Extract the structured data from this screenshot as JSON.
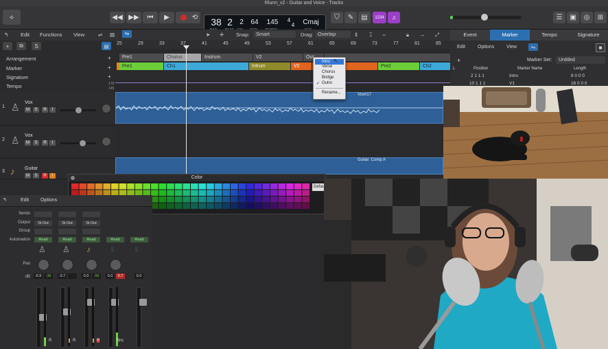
{
  "window": {
    "title": "Rlunn_v2 - Guitar and Voice - Tracks"
  },
  "transport": {
    "bar": "38",
    "beat": "2",
    "division": "2",
    "tick": "64",
    "tempo": "145",
    "timesig_top": "4",
    "timesig_bottom": "4",
    "key": "Cmaj",
    "bar_label": "BAR",
    "beat_label": "BEAT",
    "div_label": "DIV",
    "tick_label": "TICK",
    "tempo_label": "TEMPO",
    "key_label": "KEY",
    "cpu_label": "1234"
  },
  "menubar": {
    "edit": "Edit",
    "functions": "Functions",
    "view": "View",
    "snap_label": "Snap:",
    "snap_value": "Smart",
    "drag_label": "Drag:",
    "drag_value": "Overlap"
  },
  "ruler": {
    "bars": [
      "25",
      "29",
      "33",
      "37",
      "41",
      "45",
      "49",
      "53",
      "57",
      "61",
      "65",
      "69",
      "73",
      "77",
      "81",
      "85"
    ]
  },
  "global_tracks": {
    "labels": [
      "Arrangement",
      "Marker",
      "Signature",
      "Tempo"
    ],
    "arrangement": [
      "Pre1",
      "Chorus",
      "Instrum",
      "V2",
      "Out"
    ],
    "markers": [
      "Pre1",
      "Ch1",
      "Intrum",
      "V2",
      "Pre2",
      "Ch2"
    ],
    "tempo_values": [
      "170",
      "145"
    ]
  },
  "dropdown": {
    "items": [
      "Intro",
      "Verse",
      "Chorus",
      "Bridge",
      "Outro"
    ],
    "checked": "Outro",
    "rename": "Rename..."
  },
  "tracks": [
    {
      "num": "1",
      "name": "Vox",
      "region": "Vox#17"
    },
    {
      "num": "2",
      "name": "Vox",
      "region": ""
    },
    {
      "num": "3",
      "name": "Guitar",
      "region": "Guitar: Comp A"
    }
  ],
  "color_window": {
    "title": "Color",
    "default_btn": "Default"
  },
  "mixer": {
    "edit": "Edit",
    "options": "Options",
    "row_labels": {
      "sends": "Sends",
      "output": "Output",
      "group": "Group",
      "automation": "Automation",
      "pan": "Pan",
      "db": "dB"
    },
    "strips": [
      {
        "output": "St Out",
        "automation": "Read",
        "db1": "-5.9",
        "db2": "-36"
      },
      {
        "output": "St Out",
        "automation": "Read",
        "db1": "-3.7",
        "db2": ""
      },
      {
        "output": "St Out",
        "automation": "Read",
        "db1": "0.0",
        "db2": "-50"
      },
      {
        "output": "",
        "automation": "Read",
        "db1": "0.0",
        "db2": "0.7"
      },
      {
        "output": "",
        "automation": "Read",
        "db1": "0.0",
        "db2": ""
      }
    ],
    "bnc_label": "Bnc"
  },
  "inspector": {
    "tabs": [
      "Event",
      "Marker",
      "Tempo",
      "Signature"
    ],
    "active_tab": "Marker",
    "edit": "Edit",
    "functions": "Options",
    "view": "View",
    "marker_set_label": "Marker Set:",
    "marker_set_value": "Untitled",
    "columns": [
      "L",
      "Position",
      "Marker Name",
      "Length"
    ],
    "rows": [
      {
        "position": "2 1 1 1",
        "name": "Intro",
        "length": "8 0 0 0"
      },
      {
        "position": "10 1 1 1",
        "name": "V1",
        "length": "16 0 0 0"
      }
    ]
  },
  "colors": {
    "accent": "#2c6fb0",
    "region_blue": "#2f6aa6",
    "record": "#d22a2a",
    "marker_green": "#6ccf3a"
  }
}
